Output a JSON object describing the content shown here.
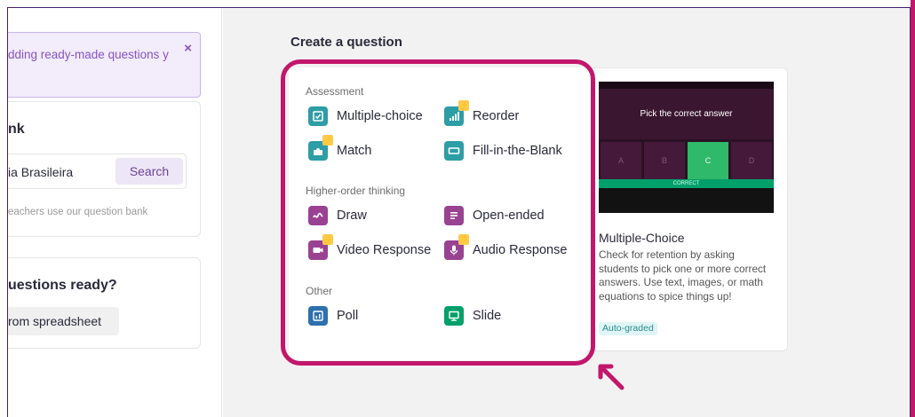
{
  "sidebar": {
    "notice_text": "dding ready-made questions y",
    "notice_close": "×",
    "bank_title": "nk",
    "search_value": "ia Brasileira",
    "search_button": "Search",
    "bank_hint": "eachers use our question bank",
    "ready_title": "uestions ready?",
    "ready_button": "rom spreadsheet"
  },
  "main": {
    "create_title": "Create a question",
    "sections": {
      "assessment": "Assessment",
      "higher_order": "Higher-order thinking",
      "other": "Other"
    },
    "items": {
      "multiple_choice": "Multiple-choice",
      "reorder": "Reorder",
      "match": "Match",
      "fill_blank": "Fill-in-the-Blank",
      "draw": "Draw",
      "open_ended": "Open-ended",
      "video_response": "Video Response",
      "audio_response": "Audio Response",
      "poll": "Poll",
      "slide": "Slide"
    },
    "preview": {
      "question": "Pick the correct answer",
      "options": [
        "A",
        "B",
        "C",
        "D"
      ],
      "correct_banner": "CORRECT",
      "title": "Multiple-Choice",
      "description": "Check for retention by asking students to pick one or more correct answers. Use text, images, or math equations to spice things up!",
      "tag": "Auto-graded"
    }
  },
  "colors": {
    "highlight": "#c2176b",
    "accent_purple": "#8854c0",
    "teal": "#2d9da6",
    "purple": "#9a4292",
    "blue": "#2d70ae",
    "green": "#00a06a"
  },
  "icons": {
    "multiple_choice": "checkbox-icon",
    "reorder": "bars-icon",
    "match": "puzzle-icon",
    "fill_blank": "blank-box-icon",
    "draw": "scribble-icon",
    "open_ended": "lines-icon",
    "video_response": "video-camera-icon",
    "audio_response": "microphone-icon",
    "poll": "poll-icon",
    "slide": "presentation-icon",
    "premium": "lightning-icon"
  }
}
